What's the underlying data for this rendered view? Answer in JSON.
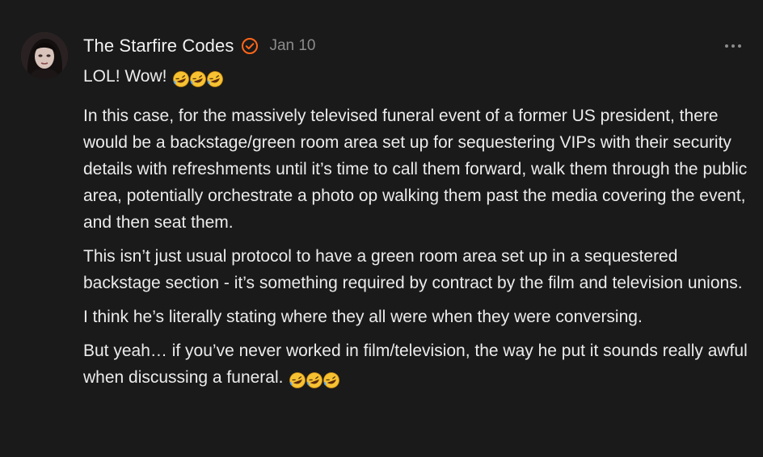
{
  "post": {
    "author": "The Starfire Codes",
    "date": "Jan 10",
    "more_label": "•••",
    "colors": {
      "background": "#1a1a1a",
      "text": "#ececec",
      "muted": "#8c8c8c",
      "verified": "#ff6719"
    },
    "icons": {
      "verified": "verified-badge-icon",
      "more": "more-options-icon",
      "emoji": "rolling-on-floor-laughing-emoji"
    },
    "paragraphs": [
      "LOL! Wow!",
      "In this case, for the massively televised funeral event of a former US president, there would be a backstage/green room area set up for sequestering VIPs with their security details with refreshments until it’s time to call them forward, walk them through the public area, potentially orchestrate a photo op walking them past the media covering the event, and then seat them.",
      "This isn’t just usual protocol to have a green room area set up in a sequestered backstage section - it’s something required by contract by the film and television unions.",
      "I think he’s literally stating where they all were when they were conversing.",
      "But yeah… if you’ve never worked in film/television, the way he put it sounds really awful when discussing a funeral."
    ]
  }
}
